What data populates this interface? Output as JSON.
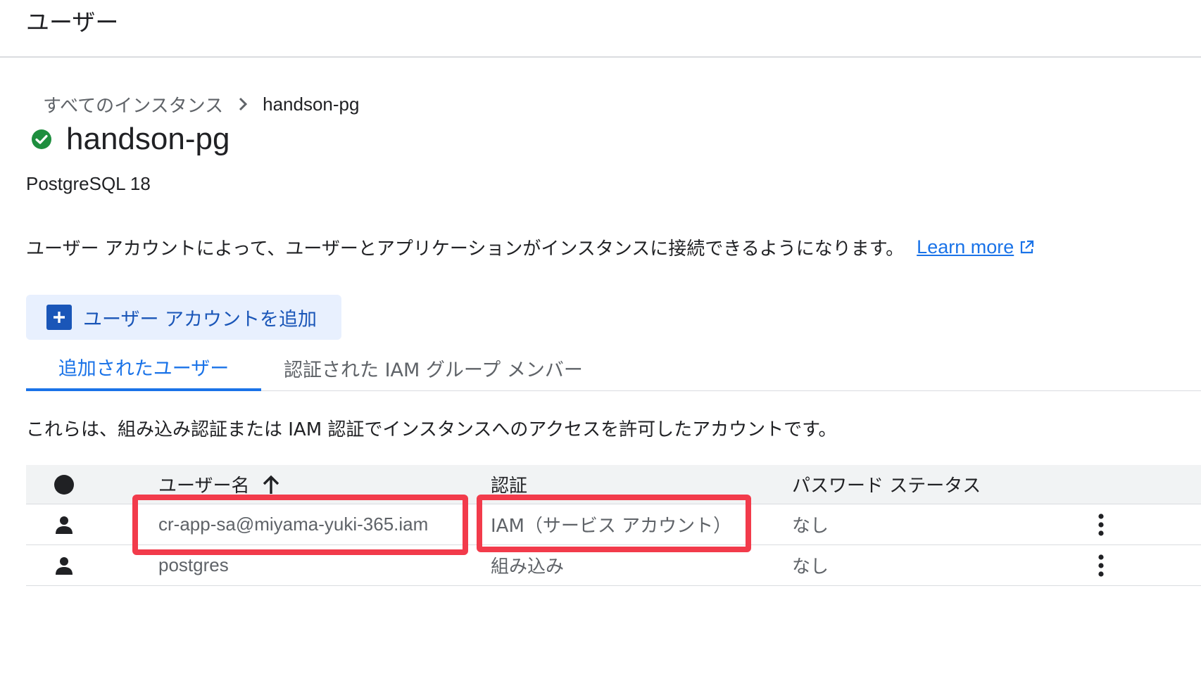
{
  "header": {
    "title": "ユーザー"
  },
  "breadcrumb": {
    "parent": "すべてのインスタンス",
    "current": "handson-pg"
  },
  "instance": {
    "name": "handson-pg",
    "status": "running",
    "status_icon": "check-circle-icon",
    "version": "PostgreSQL 18"
  },
  "description": {
    "text": "ユーザー アカウントによって、ユーザーとアプリケーションがインスタンスに接続できるようになります。",
    "learn_more": "Learn more"
  },
  "add_button": {
    "label": "ユーザー アカウントを追加",
    "icon": "add-box-icon"
  },
  "tabs": [
    {
      "label": "追加されたユーザー",
      "active": true
    },
    {
      "label": "認証された IAM グループ メンバー",
      "active": false
    }
  ],
  "table_description": "これらは、組み込み認証または IAM 認証でインスタンスへのアクセスを許可したアカウントです。",
  "table": {
    "columns": {
      "user": "ユーザー名",
      "auth": "認証",
      "password": "パスワード ステータス"
    },
    "sort": {
      "column": "user",
      "direction": "ascending",
      "icon": "arrow-upward-icon"
    },
    "rows": [
      {
        "icon": "person-icon",
        "user": "cr-app-sa@miyama-yuki-365.iam",
        "auth": "IAM（サービス アカウント）",
        "password": "なし",
        "menu_icon": "more-vert-icon"
      },
      {
        "icon": "person-icon",
        "user": "postgres",
        "auth": "組み込み",
        "password": "なし",
        "menu_icon": "more-vert-icon"
      }
    ]
  },
  "colors": {
    "accent": "#1a73e8",
    "button_bg": "#e8f0fe",
    "status_ok": "#1e8e3e",
    "highlight": "#f23b4b"
  }
}
